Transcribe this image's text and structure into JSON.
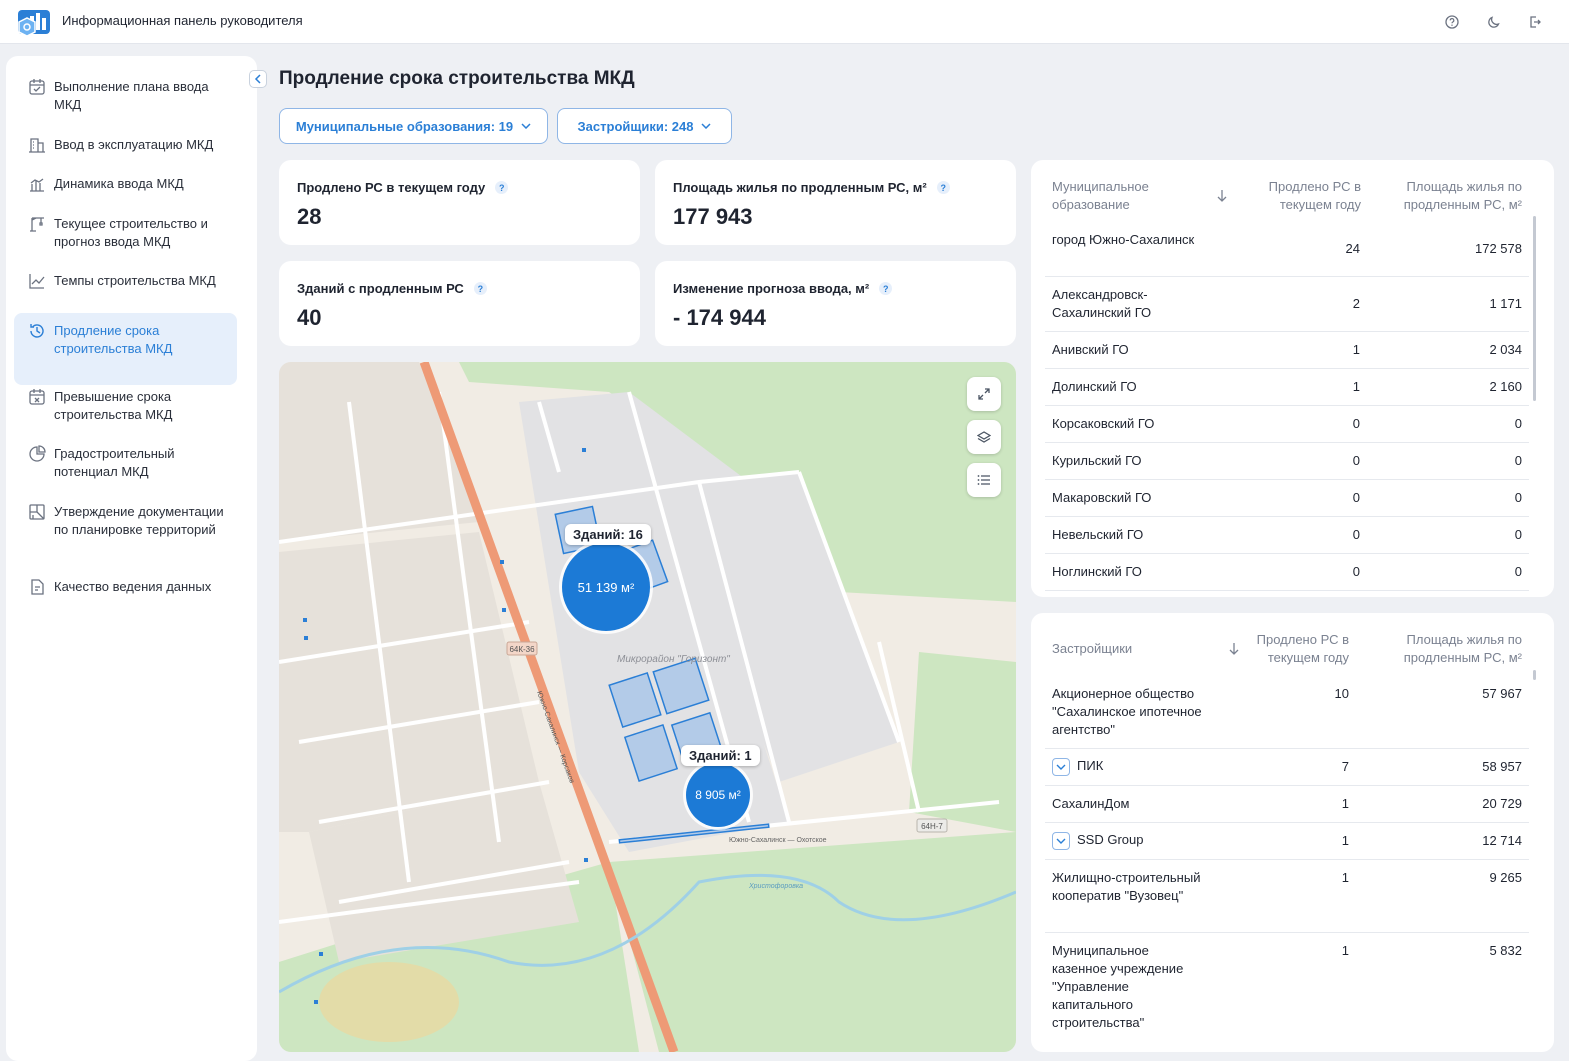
{
  "app": {
    "title": "Информационная панель руководителя"
  },
  "sidebar": {
    "items": [
      {
        "label": "Выполнение плана ввода МКД",
        "icon": "calendar-check-icon",
        "active": false
      },
      {
        "label": "Ввод в эксплуатацию МКД",
        "icon": "building-icon",
        "active": false
      },
      {
        "label": "Динамика ввода МКД",
        "icon": "bar-chart-icon",
        "active": false
      },
      {
        "label": "Текущее строительство и прогноз ввода МКД",
        "icon": "crane-icon",
        "active": false
      },
      {
        "label": "Темпы строительства МКД",
        "icon": "line-chart-icon",
        "active": false
      },
      {
        "label": "Продление срока строительства МКД",
        "icon": "history-icon",
        "active": true
      },
      {
        "label": "Превышение срока строительства МКД",
        "icon": "calendar-x-icon",
        "active": false
      },
      {
        "label": "Градостроительный потенциал МКД",
        "icon": "pie-chart-icon",
        "active": false
      },
      {
        "label": "Утверждение документации по планировке территорий",
        "icon": "map-doc-icon",
        "active": false
      },
      {
        "label": "Качество ведения данных",
        "icon": "doc-check-icon",
        "active": false
      }
    ]
  },
  "page": {
    "title": "Продление срока строительства МКД"
  },
  "filters": {
    "municipal": "Муниципальные образования: 19",
    "developers": "Застройщики: 248"
  },
  "kpis": [
    {
      "label": "Продлено РС в текущем году",
      "value": "28"
    },
    {
      "label": "Площадь жилья по продленным РС, м²",
      "value": "177 943"
    },
    {
      "label": "Зданий с продленным РС",
      "value": "40"
    },
    {
      "label": "Изменение прогноза ввода, м²",
      "value": "- 174 944"
    }
  ],
  "map": {
    "clusters": [
      {
        "tag": "Зданий: 16",
        "value": "51 139 м²"
      },
      {
        "tag": "Зданий: 1",
        "value": "8 905 м²"
      }
    ],
    "labels": {
      "district": "Микрорайон \"Горизонт\"",
      "road1": "64К-36",
      "road2": "64Н-7",
      "highway": "Южно-Сахалинск — Корсаков",
      "street1": "Южно-Сахалинск — Охотское",
      "river": "Христофоровка"
    },
    "colors": {
      "cluster": "#1c7ad6",
      "road": "#ee9a76",
      "park": "#cde6c1"
    }
  },
  "municipal_table": {
    "headers": {
      "name": "Муниципальное образование",
      "count": "Продлено РС в текущем году",
      "area": "Площадь жилья по продленным РС, м²"
    },
    "rows": [
      {
        "name": "город Южно-Сахалинск",
        "count": "24",
        "area": "172 578"
      },
      {
        "name": "Александровск-Сахалинский ГО",
        "count": "2",
        "area": "1 171"
      },
      {
        "name": "Анивский ГО",
        "count": "1",
        "area": "2 034"
      },
      {
        "name": "Долинский ГО",
        "count": "1",
        "area": "2 160"
      },
      {
        "name": "Корсаковский ГО",
        "count": "0",
        "area": "0"
      },
      {
        "name": "Курильский ГО",
        "count": "0",
        "area": "0"
      },
      {
        "name": "Макаровский ГО",
        "count": "0",
        "area": "0"
      },
      {
        "name": "Невельский ГО",
        "count": "0",
        "area": "0"
      },
      {
        "name": "Ноглинский ГО",
        "count": "0",
        "area": "0"
      }
    ]
  },
  "developers_table": {
    "headers": {
      "name": "Застройщики",
      "count": "Продлено РС в текущем году",
      "area": "Площадь жилья по продленным РС, м²"
    },
    "rows": [
      {
        "name": "Акционерное общество \"Сахалинское ипотечное агентство\"",
        "count": "10",
        "area": "57 967",
        "expandable": false
      },
      {
        "name": "ПИК",
        "count": "7",
        "area": "58 957",
        "expandable": true
      },
      {
        "name": "СахалинДом",
        "count": "1",
        "area": "20 729",
        "expandable": false
      },
      {
        "name": "SSD Group",
        "count": "1",
        "area": "12 714",
        "expandable": true
      },
      {
        "name": "Жилищно-строительный кооператив \"Вузовец\"",
        "count": "1",
        "area": "9 265",
        "expandable": false
      },
      {
        "name": "Муниципальное казенное учреждение \"Управление капитального строительства\"",
        "count": "1",
        "area": "5 832",
        "expandable": false
      }
    ]
  }
}
